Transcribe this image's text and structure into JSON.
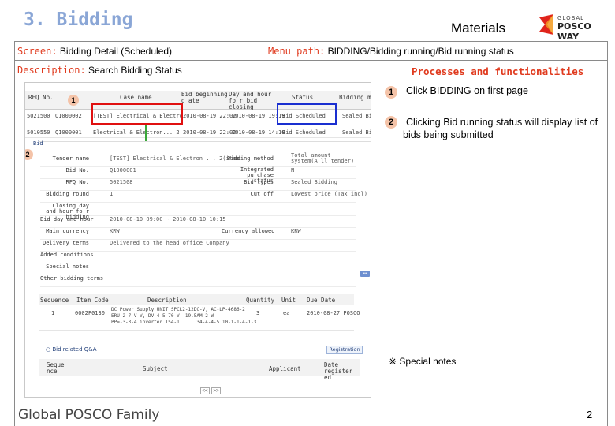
{
  "slide": {
    "title": "3. Bidding",
    "section": "Materials",
    "logo_small": "GLOBAL",
    "logo_big": "POSCO WAY"
  },
  "meta": {
    "screen_label": "Screen:",
    "screen_value": "Bidding Detail (Scheduled)",
    "menu_label": "Menu path:",
    "menu_value": "BIDDING/Bidding running/Bid running status",
    "desc_label": "Description:",
    "desc_value": "Search Bidding Status"
  },
  "processes": {
    "title": "Processes and functionalities",
    "steps": [
      {
        "num": "1",
        "text": "Click BIDDING on first page"
      },
      {
        "num": "2",
        "text": "Clicking Bid running status will display list of bids being submitted"
      }
    ],
    "special_notes": "※ Special notes"
  },
  "screenshot": {
    "grid_headers": [
      "RFQ No.",
      "Case name",
      "Bid beginning d ate",
      "Day and hour fo r bid closing",
      "Status",
      "Bidding m"
    ],
    "rows": [
      [
        "5021500",
        "Q1000002",
        "[TEST] Electrical & Electron... 2(1",
        "2010-08-19 22:02",
        "2010-08-19 19:19",
        "Bid Scheduled",
        "Sealed Bi"
      ],
      [
        "5010550",
        "Q1000001",
        "Electrical & Electron... 2(1)",
        "2010-08-19 22:02",
        "2010-08-19 14:10",
        "Bid Scheduled",
        "Sealed Bi"
      ]
    ],
    "badge1": "1",
    "badge2": "2",
    "detail_rows": [
      {
        "label": "Tender name",
        "value": "[TEST] Electrical & Electron ... 2(item",
        "label2": "Bidding method",
        "value2": "Total amount system(A ll tender)"
      },
      {
        "label": "Bid No.",
        "value": "Q1000001",
        "label2": "Integrated purchase status",
        "value2": "N"
      },
      {
        "label": "RFQ No.",
        "value": "5021508",
        "label2": "Bid types",
        "value2": "Sealed Bidding"
      },
      {
        "label": "Bidding round",
        "value": "1",
        "label2": "Cut off",
        "value2": "Lowest price (Tax incl)"
      },
      {
        "label": "Closing day and hour fo r bidding",
        "value": "",
        "label2": "",
        "value2": ""
      },
      {
        "label": "Bid day and hour",
        "value": "2010-08-10 09:00 ~ 2010-08-10 10:15",
        "label2": "",
        "value2": ""
      },
      {
        "label": "Main currency",
        "value": "KRW",
        "label2": "Currency allowed",
        "value2": "KRW"
      },
      {
        "label": "Delivery terms",
        "value": "Delivered to the head office Company",
        "label2": "",
        "value2": ""
      },
      {
        "label": "Added conditions",
        "value": "",
        "label2": "",
        "value2": ""
      },
      {
        "label": "Special notes",
        "value": "",
        "label2": "",
        "value2": ""
      },
      {
        "label": "Other bidding terms",
        "value": "",
        "label2": "",
        "value2": ""
      }
    ],
    "item_headers": [
      "Sequence",
      "Item Code",
      "Description",
      "Quantity",
      "Unit",
      "Due Date"
    ],
    "item_row": {
      "sequence": "1",
      "code": "0002F0130",
      "desc_lines": [
        "DC Power Supply UNIT SPCL2-12DC-V, AC-LP-4686-2",
        "ERU-2-7-V-V, DV-4-5-70-V, 19.5AM-2 W",
        "PP=-3-3-4 inverter 154-1..... 34-4-4-5 10-1-1-4-1-3"
      ],
      "quantity": "3",
      "unit": "ea",
      "due": "2010-08-27 POSCO"
    },
    "qna_title": "Bid related Q&A",
    "register_btn": "Registration",
    "qna_headers": [
      "Seque nce",
      "Subject",
      "Applicant",
      "Date register ed"
    ],
    "pager": [
      "<<",
      ">>"
    ]
  },
  "footer": {
    "left": "Global POSCO Family",
    "page": "2"
  },
  "colors": {
    "title": "#8aa6d6",
    "red_label": "#e03a1e",
    "badge": "#f4c3a8",
    "highlight_red": "#e01010",
    "highlight_blue": "#1a2fd0",
    "arrow_green": "#3aa83a"
  }
}
